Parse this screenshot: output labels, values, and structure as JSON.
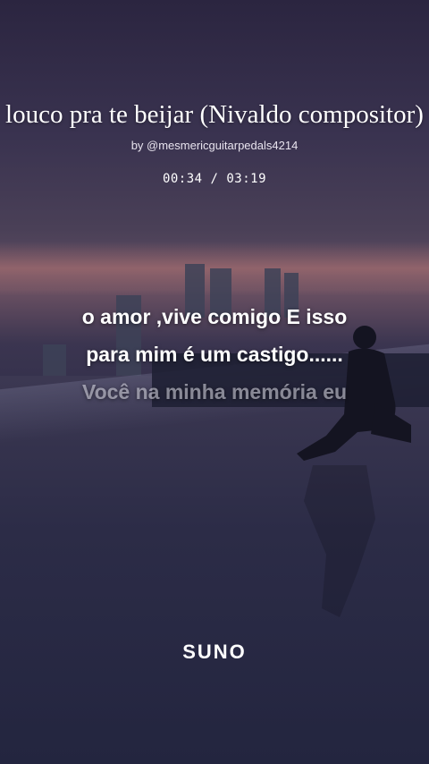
{
  "song": {
    "title": "louco pra te beijar (Nivaldo compositor)",
    "author": "by @mesmericguitarpedals4214",
    "time": "00:34 / 03:19"
  },
  "lyrics": {
    "line1": "o amor ,vive comigo  E isso",
    "line2": "para mim é um castigo......",
    "line3": "Você na minha memória   eu"
  },
  "brand": {
    "logo": "SUNO"
  }
}
